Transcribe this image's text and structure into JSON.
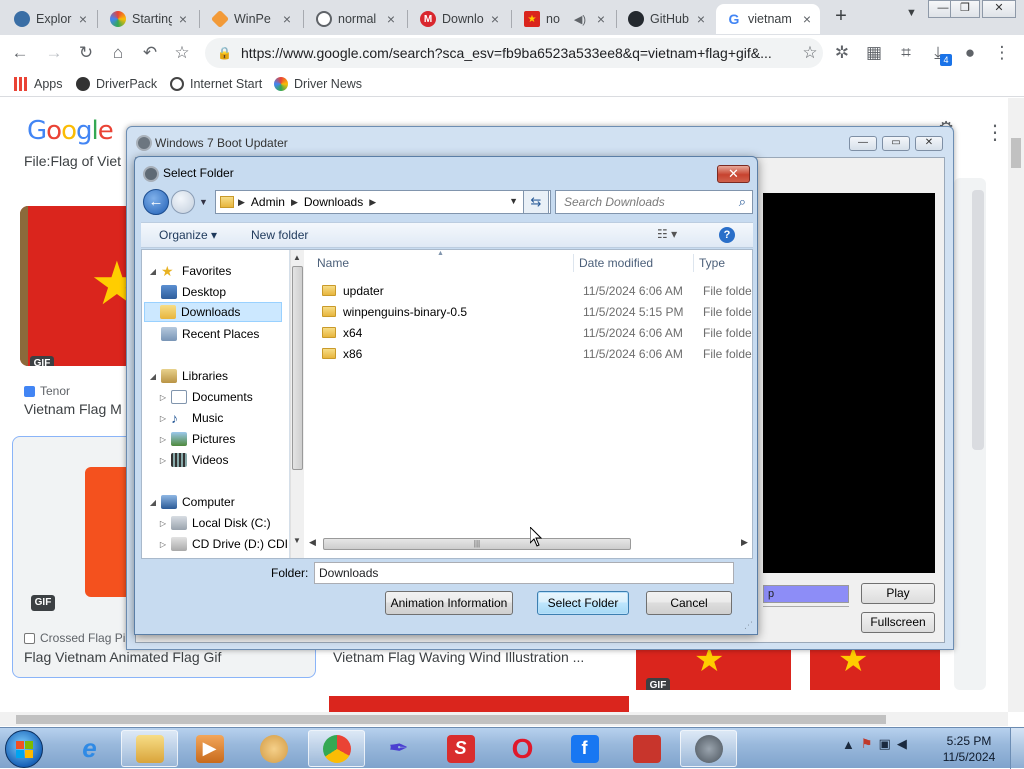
{
  "browser": {
    "tabs": [
      {
        "label": "Explore",
        "icon": "windows-explore-icon",
        "color": "#3c4043"
      },
      {
        "label": "Starting",
        "icon": "colorful-circle-icon",
        "color": "#3c4043"
      },
      {
        "label": "WinPe",
        "icon": "diamond-icon",
        "color": "#3c4043"
      },
      {
        "label": "normal",
        "icon": "globe-icon",
        "color": "#3c4043"
      },
      {
        "label": "Downlo",
        "icon": "mega-icon",
        "color": "#3c4043"
      },
      {
        "label": "no",
        "icon": "flag-icon",
        "color": "#3c4043"
      },
      {
        "label": "GitHub",
        "icon": "github-icon",
        "color": "#3c4043"
      },
      {
        "label": "vietnam",
        "icon": "google-icon",
        "color": "#3c4043"
      }
    ],
    "url": "https://www.google.com/search?sca_esv=fb9ba6523a533ee8&q=vietnam+flag+gif&...",
    "downloads_badge": "4",
    "bookmarks": [
      {
        "label": "Apps",
        "icon": "apps-grid-icon"
      },
      {
        "label": "DriverPack",
        "icon": "driverpack-icon"
      },
      {
        "label": "Internet Start",
        "icon": "globe-icon"
      },
      {
        "label": "Driver News",
        "icon": "colorful-circle-icon"
      }
    ]
  },
  "page": {
    "logo": "Google",
    "file_title": "File:Flag of Viet",
    "results": [
      {
        "source": "Tenor",
        "caption": "Vietnam Flag M",
        "badge": "GIF"
      },
      {
        "source": "Crossed Flag Pi",
        "caption": "Flag Vietnam Animated Flag Gif",
        "badge": "GIF"
      },
      {
        "source": "",
        "caption": "Vietnam Flag Waving Wind Illustration ...",
        "badge": ""
      },
      {
        "source": "",
        "caption": "",
        "badge": "GIF"
      }
    ]
  },
  "boot_updater": {
    "title": "Windows 7 Boot Updater",
    "progress_text": "p",
    "play_label": "Play",
    "fullscreen_label": "Fullscreen"
  },
  "select_folder": {
    "title": "Select Folder",
    "breadcrumb": [
      "Admin",
      "Downloads"
    ],
    "search_placeholder": "Search Downloads",
    "organize_label": "Organize",
    "new_folder_label": "New folder",
    "nav": {
      "favorites": "Favorites",
      "desktop": "Desktop",
      "downloads": "Downloads",
      "recent_places": "Recent Places",
      "libraries": "Libraries",
      "documents": "Documents",
      "music": "Music",
      "pictures": "Pictures",
      "videos": "Videos",
      "computer": "Computer",
      "local_disk": "Local Disk (C:)",
      "cd_drive": "CD Drive (D:) CDI"
    },
    "columns": {
      "name": "Name",
      "date": "Date modified",
      "type": "Type"
    },
    "files": [
      {
        "name": "updater",
        "date": "11/5/2024 6:06 AM",
        "type": "File folder"
      },
      {
        "name": "winpenguins-binary-0.5",
        "date": "11/5/2024 5:15 PM",
        "type": "File folder"
      },
      {
        "name": "x64",
        "date": "11/5/2024 6:06 AM",
        "type": "File folder"
      },
      {
        "name": "x86",
        "date": "11/5/2024 6:06 AM",
        "type": "File folder"
      }
    ],
    "folder_label": "Folder:",
    "folder_value": "Downloads",
    "animation_info_label": "Animation Information",
    "select_folder_label": "Select Folder",
    "cancel_label": "Cancel"
  },
  "taskbar": {
    "time": "5:25 PM",
    "date": "11/5/2024"
  }
}
